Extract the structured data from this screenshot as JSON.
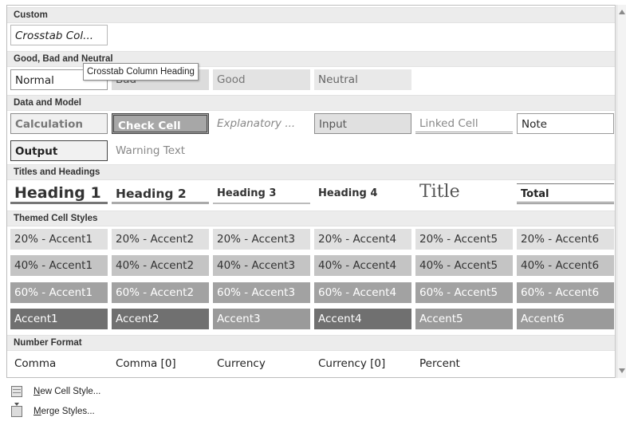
{
  "sections": [
    {
      "id": "custom",
      "label": "Custom",
      "styles": [
        {
          "name": "crosstab-column-heading",
          "label": "Crosstab Col..."
        }
      ]
    },
    {
      "id": "good-bad-neutral",
      "label": "Good, Bad and Neutral",
      "styles": [
        {
          "name": "normal",
          "label": "Normal"
        },
        {
          "name": "bad",
          "label": "Bad"
        },
        {
          "name": "good",
          "label": "Good"
        },
        {
          "name": "neutral",
          "label": "Neutral"
        }
      ]
    },
    {
      "id": "data-model",
      "label": "Data and Model",
      "styles": [
        {
          "name": "calculation",
          "label": "Calculation"
        },
        {
          "name": "check-cell",
          "label": "Check Cell"
        },
        {
          "name": "explanatory",
          "label": "Explanatory ..."
        },
        {
          "name": "input",
          "label": "Input"
        },
        {
          "name": "linked-cell",
          "label": "Linked Cell"
        },
        {
          "name": "note",
          "label": "Note"
        },
        {
          "name": "output",
          "label": "Output"
        },
        {
          "name": "warning-text",
          "label": "Warning Text"
        }
      ]
    },
    {
      "id": "titles-headings",
      "label": "Titles and Headings",
      "styles": [
        {
          "name": "heading-1",
          "label": "Heading 1"
        },
        {
          "name": "heading-2",
          "label": "Heading 2"
        },
        {
          "name": "heading-3",
          "label": "Heading 3"
        },
        {
          "name": "heading-4",
          "label": "Heading 4"
        },
        {
          "name": "title",
          "label": "Title"
        },
        {
          "name": "total",
          "label": "Total"
        }
      ]
    },
    {
      "id": "themed",
      "label": "Themed Cell Styles",
      "styles": [
        {
          "name": "20-accent1",
          "label": "20% - Accent1"
        },
        {
          "name": "20-accent2",
          "label": "20% - Accent2"
        },
        {
          "name": "20-accent3",
          "label": "20% - Accent3"
        },
        {
          "name": "20-accent4",
          "label": "20% - Accent4"
        },
        {
          "name": "20-accent5",
          "label": "20% - Accent5"
        },
        {
          "name": "20-accent6",
          "label": "20% - Accent6"
        },
        {
          "name": "40-accent1",
          "label": "40% - Accent1"
        },
        {
          "name": "40-accent2",
          "label": "40% - Accent2"
        },
        {
          "name": "40-accent3",
          "label": "40% - Accent3"
        },
        {
          "name": "40-accent4",
          "label": "40% - Accent4"
        },
        {
          "name": "40-accent5",
          "label": "40% - Accent5"
        },
        {
          "name": "40-accent6",
          "label": "40% - Accent6"
        },
        {
          "name": "60-accent1",
          "label": "60% - Accent1"
        },
        {
          "name": "60-accent2",
          "label": "60% - Accent2"
        },
        {
          "name": "60-accent3",
          "label": "60% - Accent3"
        },
        {
          "name": "60-accent4",
          "label": "60% - Accent4"
        },
        {
          "name": "60-accent5",
          "label": "60% - Accent5"
        },
        {
          "name": "60-accent6",
          "label": "60% - Accent6"
        },
        {
          "name": "accent1",
          "label": "Accent1"
        },
        {
          "name": "accent2",
          "label": "Accent2"
        },
        {
          "name": "accent3",
          "label": "Accent3"
        },
        {
          "name": "accent4",
          "label": "Accent4"
        },
        {
          "name": "accent5",
          "label": "Accent5"
        },
        {
          "name": "accent6",
          "label": "Accent6"
        }
      ]
    },
    {
      "id": "number-format",
      "label": "Number Format",
      "styles": [
        {
          "name": "comma",
          "label": "Comma"
        },
        {
          "name": "comma-0",
          "label": "Comma [0]"
        },
        {
          "name": "currency",
          "label": "Currency"
        },
        {
          "name": "currency-0",
          "label": "Currency [0]"
        },
        {
          "name": "percent",
          "label": "Percent"
        }
      ]
    }
  ],
  "tooltip": "Crosstab Column Heading",
  "commands": [
    {
      "name": "new-cell-style",
      "icon": "new-cell-style-icon",
      "mnemonic": "N",
      "rest": "ew Cell Style..."
    },
    {
      "name": "merge-styles",
      "icon": "merge-styles-icon",
      "mnemonic": "M",
      "rest": "erge Styles..."
    }
  ],
  "colors": {
    "section_header_bg": "#ececec",
    "accent_20": "#e0e0e0",
    "accent_40": "#c4c4c4",
    "accent_60": "#a2a2a2",
    "accent_100_dark": "#707070",
    "accent_100_light": "#9a9a9a"
  }
}
